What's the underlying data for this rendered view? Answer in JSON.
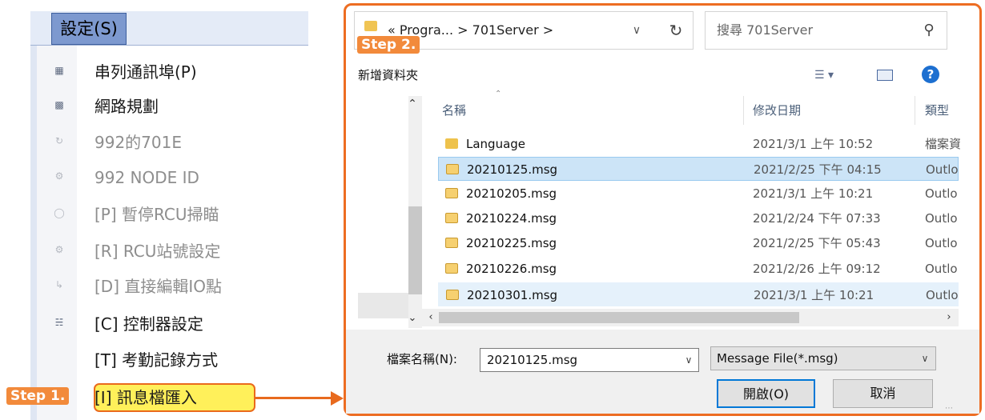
{
  "menu": {
    "title": "設定(S)",
    "items": [
      {
        "label": "串列通訊埠(P)",
        "icon": "serial-port-icon",
        "enabled": true
      },
      {
        "label": "網路規劃",
        "icon": "network-icon",
        "enabled": true
      },
      {
        "label": "992的701E",
        "icon": "refresh-link-icon",
        "enabled": false
      },
      {
        "label": "992 NODE ID",
        "icon": "node-id-icon",
        "enabled": false
      },
      {
        "label": "[P] 暫停RCU掃瞄",
        "icon": "pause-scan-icon",
        "enabled": false
      },
      {
        "label": "[R] RCU站號設定",
        "icon": "station-number-icon",
        "enabled": false
      },
      {
        "label": "[D] 直接編輯IO點",
        "icon": "edit-io-icon",
        "enabled": false
      },
      {
        "label": "[C] 控制器設定",
        "icon": "controller-icon",
        "enabled": true
      },
      {
        "label": "[T] 考勤記錄方式",
        "icon": "",
        "enabled": true
      },
      {
        "label": "[I] 訊息檔匯入",
        "icon": "",
        "enabled": true,
        "highlighted": true
      }
    ]
  },
  "steps": {
    "step1": "Step 1.",
    "step2": "Step 2."
  },
  "dialog": {
    "breadcrumb": "« Progra...  >  701Server  >",
    "search_placeholder": "搜尋 701Server",
    "new_folder": "新增資料夾",
    "columns": {
      "name": "名稱",
      "date": "修改日期",
      "type": "類型"
    },
    "files": [
      {
        "name": "Language",
        "date": "2021/3/1 上午 10:52",
        "type": "檔案資",
        "kind": "folder",
        "selected": false
      },
      {
        "name": "20210125.msg",
        "date": "2021/2/25 下午 04:15",
        "type": "Outlo",
        "kind": "mail",
        "selected": true
      },
      {
        "name": "20210205.msg",
        "date": "2021/3/1 上午 10:21",
        "type": "Outlo",
        "kind": "mail",
        "selected": false
      },
      {
        "name": "20210224.msg",
        "date": "2021/2/24 下午 07:33",
        "type": "Outlo",
        "kind": "mail",
        "selected": false
      },
      {
        "name": "20210225.msg",
        "date": "2021/2/25 下午 05:43",
        "type": "Outlo",
        "kind": "mail",
        "selected": false
      },
      {
        "name": "20210226.msg",
        "date": "2021/2/26 上午 09:12",
        "type": "Outlo",
        "kind": "mail",
        "selected": false
      },
      {
        "name": "20210301.msg",
        "date": "2021/3/1 上午 10:21",
        "type": "Outlo",
        "kind": "mail",
        "selected": true
      }
    ],
    "filename_label": "檔案名稱(N):",
    "filename_value": "20210125.msg",
    "filetype_value": "Message File(*.msg)",
    "open_label": "開啟(O)",
    "cancel_label": "取消"
  },
  "colors": {
    "accent_orange": "#ed6d22",
    "highlight_yellow": "#fff05a",
    "selection_blue": "#cce4f7",
    "menu_header_blue": "#7d99cf"
  }
}
